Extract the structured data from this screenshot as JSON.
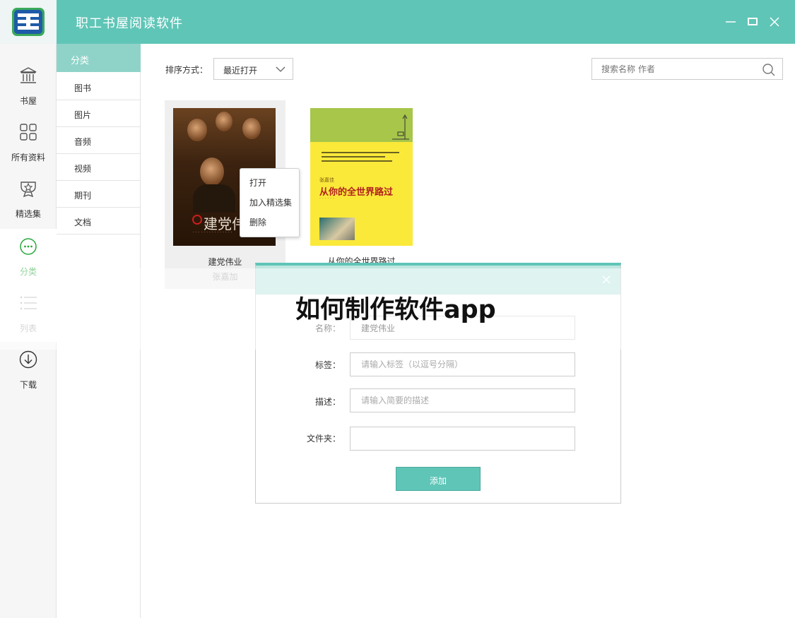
{
  "app": {
    "title": "职工书屋阅读软件",
    "accent": "#5fc5b7",
    "active_color": "#28a73b"
  },
  "window_controls": [
    "minimize-icon",
    "maximize-icon",
    "close-icon"
  ],
  "nav": {
    "items": [
      {
        "label": "书屋",
        "icon": "library-icon"
      },
      {
        "label": "所有资料",
        "icon": "grid-icon"
      },
      {
        "label": "精选集",
        "icon": "award-icon"
      },
      {
        "label": "分类",
        "icon": "more-circle-icon",
        "active": true
      },
      {
        "label": "列表",
        "icon": "list-icon"
      },
      {
        "label": "下载",
        "icon": "download-icon"
      }
    ]
  },
  "categories": {
    "header": "分类",
    "items": [
      "图书",
      "图片",
      "音频",
      "视频",
      "期刊",
      "文档"
    ]
  },
  "toolbar": {
    "sort_label": "排序方式：",
    "sort_value": "最近打开",
    "search_placeholder": "搜索名称 作者"
  },
  "books": [
    {
      "title": "建党伟业",
      "author": "张嘉加",
      "cover_title": "建党伟"
    },
    {
      "title": "从你的全世界路过",
      "cover_author": "张嘉佳",
      "cover_title": "从你的全世界路过"
    }
  ],
  "context_menu": {
    "items": [
      "打开",
      "加入精选集",
      "删除"
    ]
  },
  "dialog": {
    "fields": [
      {
        "label": "名称：",
        "value": "建党伟业",
        "placeholder": ""
      },
      {
        "label": "标签：",
        "value": "",
        "placeholder": "请输入标签（以逗号分隔）"
      },
      {
        "label": "描述：",
        "value": "",
        "placeholder": "请输入简要的描述"
      },
      {
        "label": "文件夹：",
        "value": "",
        "placeholder": ""
      }
    ],
    "submit_label": "添加"
  },
  "watermark": "如何制作软件app"
}
